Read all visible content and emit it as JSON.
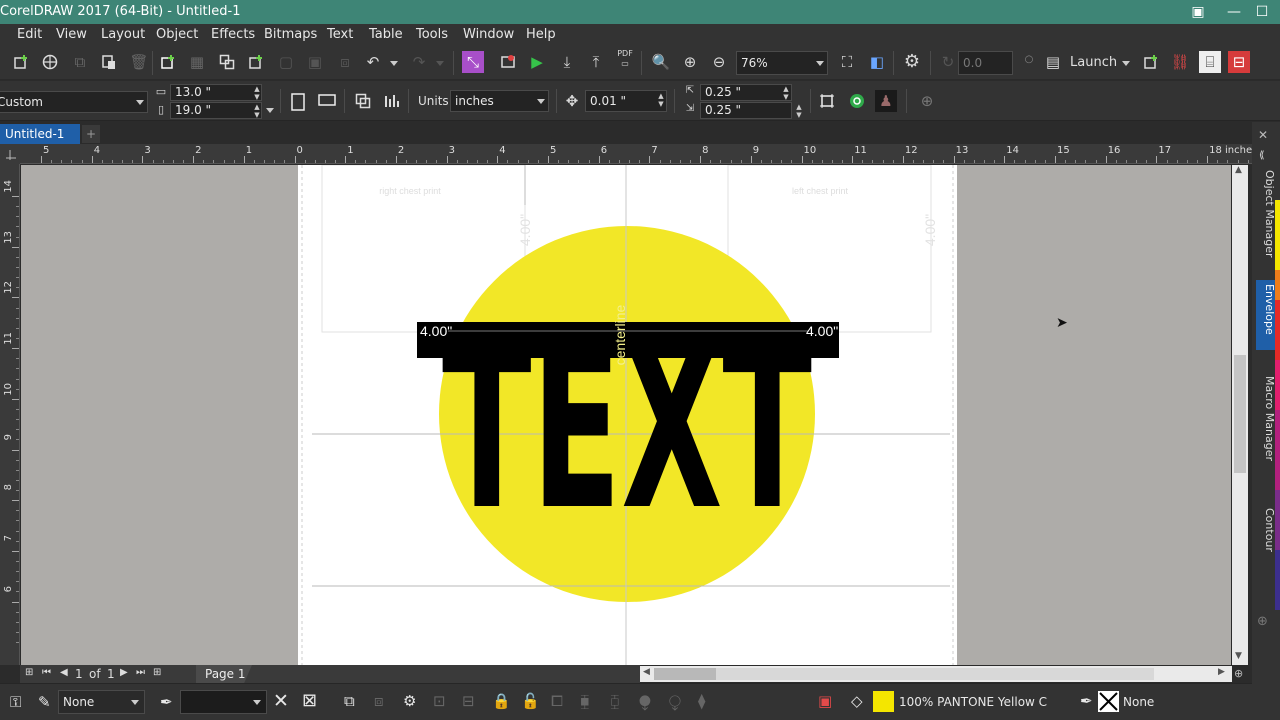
{
  "app": {
    "title": "CorelDRAW 2017 (64-Bit) - Untitled-1",
    "colors": {
      "titlebar": "#3e8576",
      "chrome": "#333333",
      "accent_tab": "#1f5fa8",
      "desktop": "#aeaca9",
      "circle": "#f2e727"
    }
  },
  "window_controls": {
    "minimize": "—",
    "maximize": "☐",
    "close": "✕"
  },
  "menu": [
    "Edit",
    "View",
    "Layout",
    "Object",
    "Effects",
    "Bitmaps",
    "Text",
    "Table",
    "Tools",
    "Window",
    "Help"
  ],
  "toolbar": {
    "zoom_value": "76%",
    "rotation_value": "0.0",
    "launch_label": "Launch",
    "pdf_label": "PDF"
  },
  "property_bar": {
    "page_preset": "Custom",
    "width": "13.0 \"",
    "height": "19.0 \"",
    "units_label": "Units:",
    "units_value": "inches",
    "nudge": "0.01 \"",
    "dup_x": "0.25 \"",
    "dup_y": "0.25 \""
  },
  "doc_tab": {
    "label": "Untitled-1",
    "add": "+"
  },
  "rulers": {
    "h_labels": [
      "5",
      "4",
      "3",
      "2",
      "1",
      "0",
      "1",
      "2",
      "3",
      "4",
      "5",
      "6",
      "7",
      "8",
      "9",
      "10",
      "11",
      "12",
      "13",
      "14",
      "15",
      "16",
      "17",
      "18 inches"
    ],
    "v_labels": [
      "14",
      "13",
      "12",
      "11",
      "10",
      "9",
      "8",
      "7",
      "6"
    ]
  },
  "canvas": {
    "big_text": "TEXT",
    "guide_left_label": "right chest print",
    "guide_right_label": "left chest print",
    "dim_vertical": "4.00\"",
    "dim_left": "4.00\"",
    "dim_right": "4.00\"",
    "center_line_label": "centerline"
  },
  "page_nav": {
    "current": "1",
    "of_label": "of",
    "total": "1",
    "page_tab": "Page 1"
  },
  "dockers": [
    "Object Manager",
    "Envelope",
    "Macro Manager",
    "Contour"
  ],
  "status": {
    "fill_none": "None",
    "fill_color_text": "100% PANTONE Yellow C",
    "outline_text": "None"
  }
}
